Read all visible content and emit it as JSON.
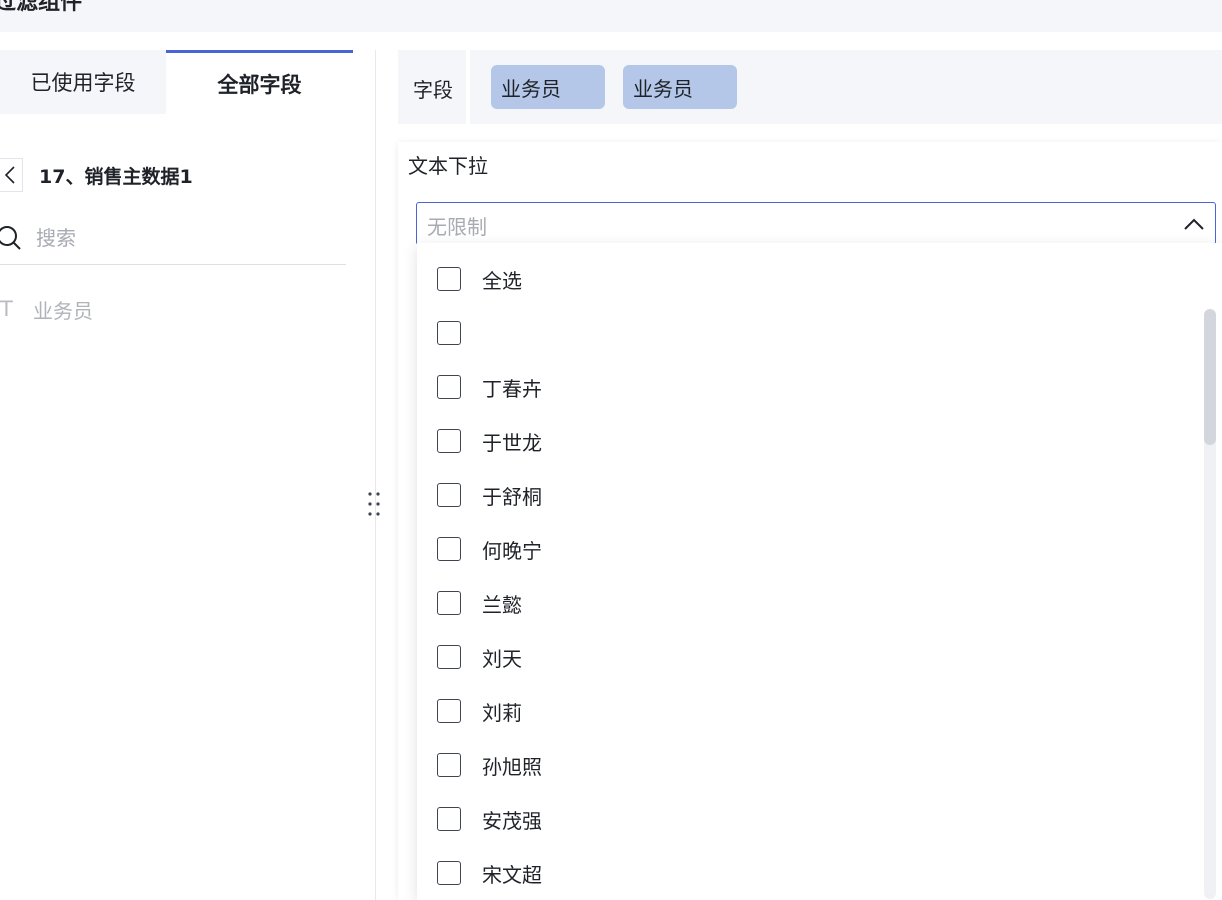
{
  "header": {
    "title": "过滤组件"
  },
  "left_panel": {
    "tabs": [
      {
        "label": "已使用字段",
        "active": false
      },
      {
        "label": "全部字段",
        "active": true
      }
    ],
    "dataset_name": "17、销售主数据1",
    "search": {
      "placeholder": "搜索",
      "value": ""
    },
    "fields": [
      {
        "type_icon": "T",
        "label": "业务员"
      }
    ]
  },
  "fields_bar": {
    "label": "字段",
    "chips": [
      "业务员",
      "业务员"
    ]
  },
  "config": {
    "section_title": "文本下拉",
    "select": {
      "value": "无限制",
      "open": true
    }
  },
  "dropdown": {
    "options": [
      {
        "label": "全选",
        "checked": false
      },
      {
        "label": "",
        "checked": false
      },
      {
        "label": "丁春卉",
        "checked": false
      },
      {
        "label": "于世龙",
        "checked": false
      },
      {
        "label": "于舒桐",
        "checked": false
      },
      {
        "label": "何晚宁",
        "checked": false
      },
      {
        "label": "兰懿",
        "checked": false
      },
      {
        "label": "刘天",
        "checked": false
      },
      {
        "label": "刘莉",
        "checked": false
      },
      {
        "label": "孙旭照",
        "checked": false
      },
      {
        "label": "安茂强",
        "checked": false
      },
      {
        "label": "宋文超",
        "checked": false
      }
    ]
  },
  "colors": {
    "accent": "#4a64d6",
    "chip_bg": "#b4c7e8",
    "panel_bg": "#f5f6fa",
    "placeholder": "#a8abb2"
  },
  "icons": [
    "back-chevron-icon",
    "search-icon",
    "text-field-icon",
    "drag-handle-icon",
    "chevron-up-icon"
  ]
}
